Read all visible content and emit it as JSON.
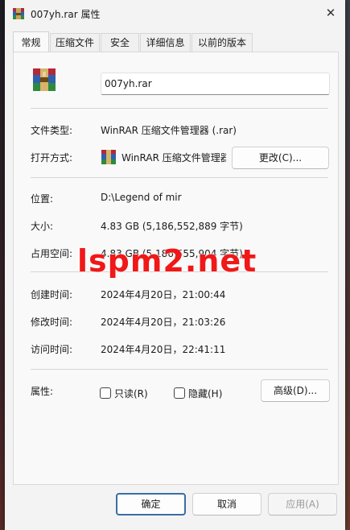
{
  "window": {
    "title": "007yh.rar 属性",
    "close_glyph": "✕"
  },
  "tabs": [
    {
      "label": "常规"
    },
    {
      "label": "压缩文件"
    },
    {
      "label": "安全"
    },
    {
      "label": "详细信息"
    },
    {
      "label": "以前的版本"
    }
  ],
  "general": {
    "file_name": "007yh.rar",
    "file_type_label": "文件类型:",
    "file_type_value": "WinRAR 压缩文件管理器 (.rar)",
    "open_with_label": "打开方式:",
    "open_with_value": "WinRAR 压缩文件管理器",
    "change_button": "更改(C)...",
    "location_label": "位置:",
    "location_value": "D:\\Legend of mir",
    "size_label": "大小:",
    "size_value": "4.83 GB (5,186,552,889 字节)",
    "size_on_disk_label": "占用空间:",
    "size_on_disk_value": "4.83 GB (5,186,555,904 字节)",
    "created_label": "创建时间:",
    "created_value": "2024年4月20日，21:00:44",
    "modified_label": "修改时间:",
    "modified_value": "2024年4月20日，21:03:26",
    "accessed_label": "访问时间:",
    "accessed_value": "2024年4月20日，22:41:11",
    "attributes_label": "属性:",
    "readonly_label": "只读(R)",
    "hidden_label": "隐藏(H)",
    "advanced_button": "高级(D)..."
  },
  "footer": {
    "ok": "确定",
    "cancel": "取消",
    "apply": "应用(A)"
  },
  "watermark": "lspm2.net",
  "colors": {
    "watermark": "#f01818",
    "dialog_bg": "#f3f3f3",
    "panel_bg": "#f9f9f9",
    "ok_border": "#3a6ea5"
  },
  "icons": {
    "file_icon": "winrar-archive-icon",
    "app_icon": "winrar-app-icon",
    "close": "close-icon"
  }
}
